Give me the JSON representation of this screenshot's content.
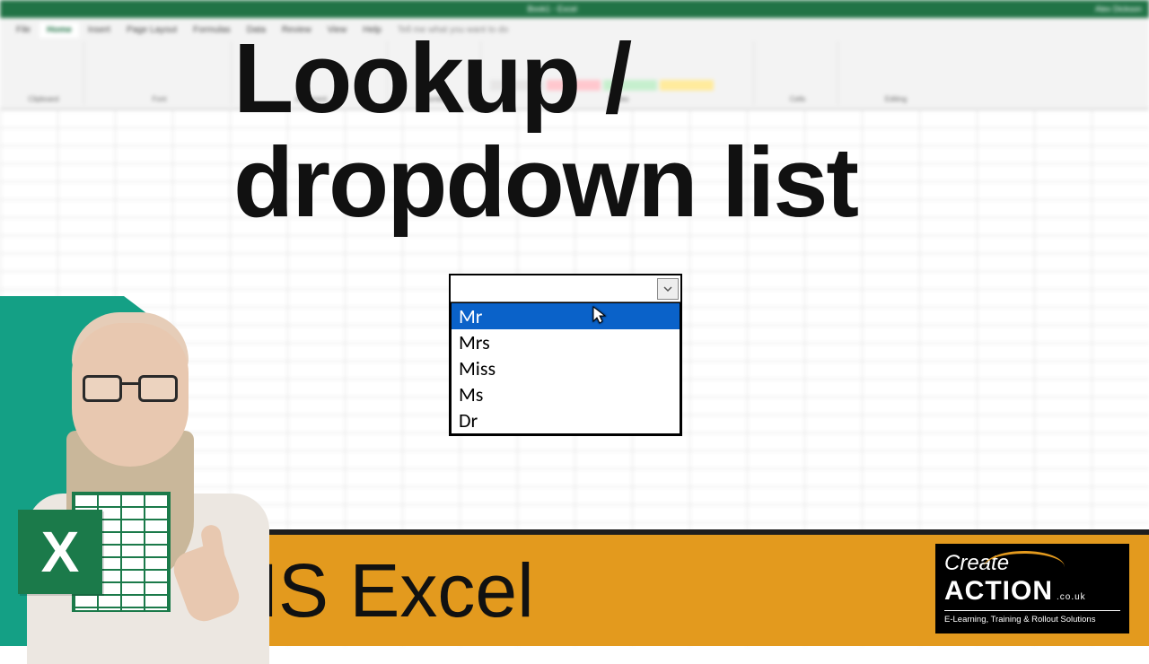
{
  "titlebar": {
    "center": "Book1 - Excel",
    "user": "Alex Dickson"
  },
  "tabs": [
    "File",
    "Home",
    "Insert",
    "Page Layout",
    "Formulas",
    "Data",
    "Review",
    "View",
    "Help"
  ],
  "tellme": "Tell me what you want to do",
  "ribbon_groups": [
    "Clipboard",
    "Font",
    "Alignment",
    "Number",
    "Styles",
    "Cells",
    "Editing"
  ],
  "style_swatches": [
    "Normal",
    "Bad",
    "Good",
    "Neutral"
  ],
  "headline": {
    "line1": "Lookup /",
    "line2": "dropdown list"
  },
  "dropdown": {
    "selected_index": 0,
    "items": [
      "Mr",
      "Mrs",
      "Miss",
      "Ms",
      "Dr"
    ]
  },
  "excel_logo_letter": "X",
  "footer_label": "MS Excel",
  "ca": {
    "l1": "Create",
    "l2": "ACTION",
    "couk": ".co.uk",
    "tag": "E-Learning, Training & Rollout Solutions"
  }
}
